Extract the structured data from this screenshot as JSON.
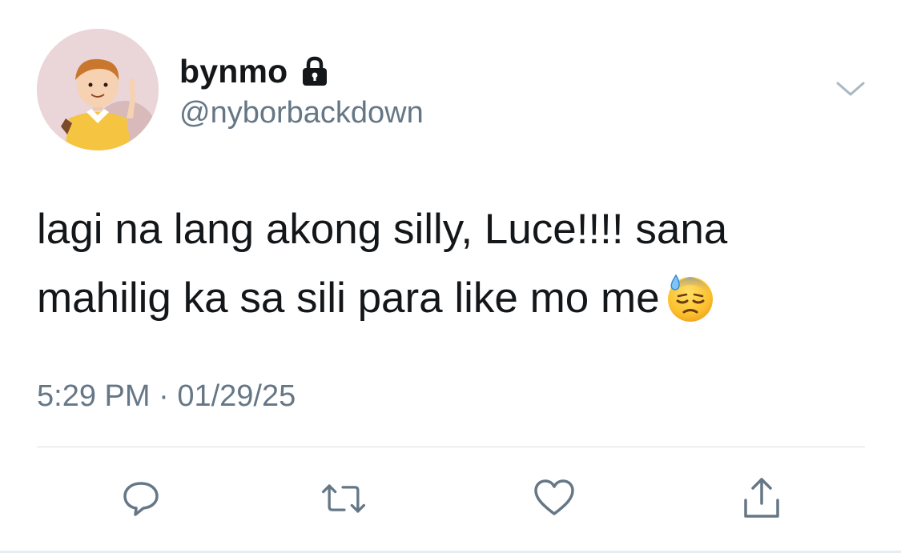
{
  "author": {
    "display_name": "bynmo",
    "handle": "@nyborbackdown",
    "protected_icon": "lock-icon",
    "avatar": "cartoon-boy-avatar"
  },
  "tweet": {
    "text_line_1": "lagi na lang akong silly, Luce!!!! sana",
    "text_line_2": "mahilig ka sa sili para like mo me",
    "emoji": "downcast-face-with-sweat-emoji",
    "time": "5:29 PM",
    "separator": "·",
    "date": "01/29/25"
  },
  "actions": {
    "reply": "reply-icon",
    "retweet": "retweet-icon",
    "like": "heart-icon",
    "share": "share-icon",
    "more": "chevron-down-icon"
  },
  "colors": {
    "text": "#14171a",
    "secondary": "#657786",
    "divider": "#d7dde2"
  }
}
